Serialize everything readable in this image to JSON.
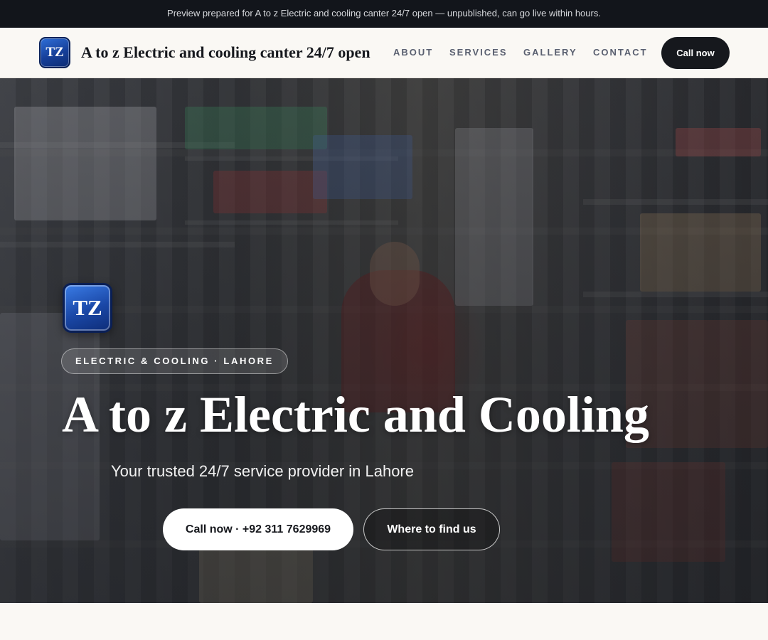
{
  "preview_banner": {
    "text": "Preview prepared for A to z Electric and cooling canter 24/7 open — unpublished, can go live within hours."
  },
  "header": {
    "logo_text": "TZ",
    "brand_name": "A to z Electric and cooling canter 24/7 open",
    "nav": [
      "ABOUT",
      "SERVICES",
      "GALLERY",
      "CONTACT"
    ],
    "call_label": "Call now"
  },
  "hero": {
    "logo_text": "TZ",
    "eyebrow": "ELECTRIC & COOLING · LAHORE",
    "title": "A to z Electric and Cooling",
    "subtitle": "Your trusted 24/7 service provider in Lahore",
    "primary_button": "Call now · +92 311 7629969",
    "secondary_button": "Where to find us"
  },
  "colors": {
    "banner_bg": "#12151b",
    "nav_bg": "#faf8f4",
    "dark_button": "#16181d",
    "logo_blue": "#163f99"
  }
}
